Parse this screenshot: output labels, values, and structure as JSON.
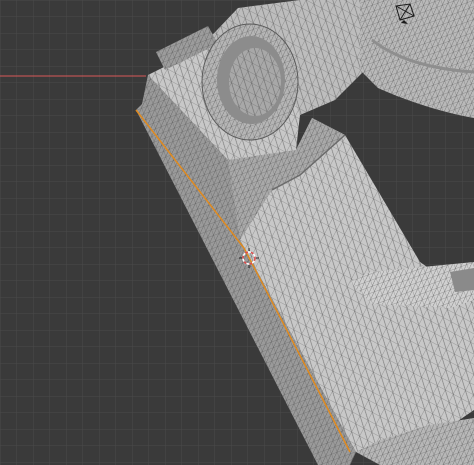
{
  "viewport": {
    "background_color": "#3a3a3a",
    "grid_color": "#4a4a4a",
    "x_axis_color": "#d85858",
    "mesh_face_color": "#c9c9c9",
    "mesh_dark_color": "#8e8e8e",
    "wire_color": "#4c4c4c",
    "selected_edge_color": "#e08a1e"
  },
  "cursor": {
    "icon": "3d-cursor-icon"
  },
  "gizmo": {
    "icon": "camera-gizmo-icon"
  }
}
